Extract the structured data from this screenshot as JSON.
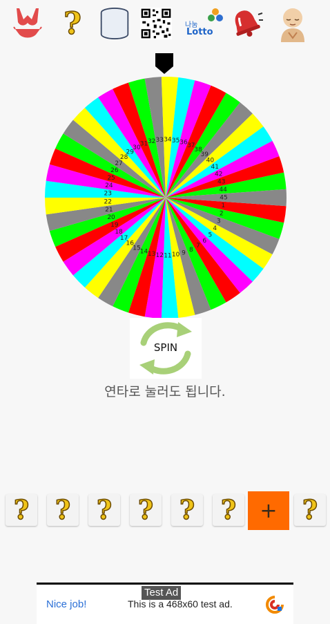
{
  "toolbar": {
    "items": [
      {
        "icon": "bikini-icon"
      },
      {
        "icon": "question-mark-icon"
      },
      {
        "icon": "database-icon"
      },
      {
        "icon": "qr-code-icon"
      },
      {
        "icon": "lotto-logo-icon",
        "label_small": "나눔",
        "label": "Lotto"
      },
      {
        "icon": "bell-icon"
      },
      {
        "icon": "monk-icon"
      }
    ]
  },
  "wheel": {
    "numbers": [
      "1",
      "2",
      "3",
      "4",
      "5",
      "6",
      "7",
      "8",
      "9",
      "10",
      "11",
      "12",
      "13",
      "14",
      "15",
      "16",
      "17",
      "18",
      "19",
      "20",
      "21",
      "22",
      "23",
      "24",
      "25",
      "26",
      "27",
      "28",
      "29",
      "30",
      "31",
      "32",
      "33",
      "34",
      "35",
      "36",
      "37",
      "38",
      "39",
      "40",
      "41",
      "42",
      "43",
      "44",
      "45"
    ],
    "colors": [
      "#ff0000",
      "#00ff00",
      "#888888",
      "#ffff00",
      "#00ffff",
      "#ff00ff"
    ]
  },
  "spin": {
    "label": "SPIN"
  },
  "hint": "연타로 눌러도 됩니다.",
  "slots": [
    "?",
    "?",
    "?",
    "?",
    "?",
    "?",
    "+",
    "?"
  ],
  "ad": {
    "tag": "Test Ad",
    "nice": "Nice job!",
    "text": "This is a 468x60 test ad."
  }
}
